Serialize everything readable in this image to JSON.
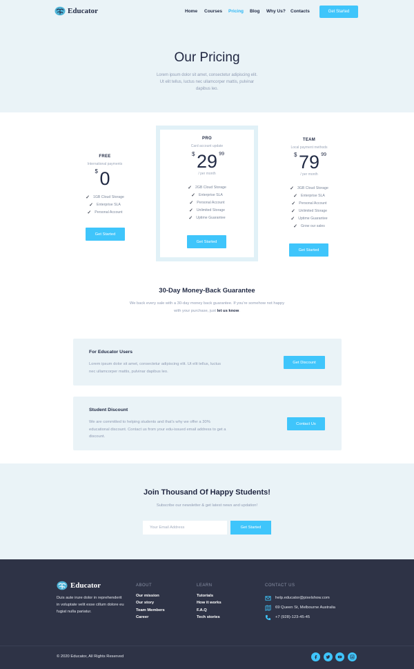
{
  "brand": {
    "name": "Educator",
    "accent": "#3fc5fb"
  },
  "nav": {
    "items": [
      {
        "label": "Home",
        "active": false
      },
      {
        "label": "Courses",
        "active": false
      },
      {
        "label": "Pricing",
        "active": true
      },
      {
        "label": "Blog",
        "active": false
      },
      {
        "label": "Why Us?",
        "active": false
      },
      {
        "label": "Contacts",
        "active": false
      }
    ],
    "cta": "Get Started"
  },
  "hero": {
    "title": "Our Pricing",
    "subtitle": "Lorem ipsum dolor sit amet, consectetur adipiscing elit. Ut elit tellus, luctus nec ullamcorper mattis, pulvinar dapibus leo."
  },
  "plans": [
    {
      "name": "FREE",
      "desc": "International payments",
      "currency": "$",
      "amount": "0",
      "cents": "",
      "period": "",
      "features": [
        "1GB Cloud Storage",
        "Enterprise SLA",
        "Personal Account"
      ],
      "button": "Get Started"
    },
    {
      "name": "PRO",
      "desc": "Card account update",
      "currency": "$",
      "amount": "29",
      "cents": "99",
      "period": "/ per month",
      "features": [
        "2GB Cloud Storage",
        "Enterprise SLA",
        "Personal Account",
        "Unlimited Storage",
        "Uptime Guarantee"
      ],
      "button": "Get Started"
    },
    {
      "name": "TEAM",
      "desc": "Local payment methods",
      "currency": "$",
      "amount": "79",
      "cents": "99",
      "period": "/ per month",
      "features": [
        "3GB Cloud Storage",
        "Enterprise SLA",
        "Personal Account",
        "Unlimited Storage",
        "Uptime Guarantee",
        "Grow our sales"
      ],
      "button": "Get Started"
    }
  ],
  "guarantee": {
    "title": "30-Day Money-Back Guarantee",
    "text": "We back every sale with a 30-day money back guarantee. If you're somehow not happy with your purchase, just",
    "link": "let us know",
    "end": "."
  },
  "cards": [
    {
      "title": "For Educator Users",
      "text": "Lorem ipsum dolor sit amet, consectetur adipiscing elit. Ut elit tellus, luctus nec ullamcorper mattis, pulvinar dapibus leo.",
      "button": "Get Discount"
    },
    {
      "title": "Student Discount",
      "text": "We are committed to helping students and that's why we offer a 30% educational discount. Contact us from your edu-issued email address to get a discount.",
      "button": "Contact Us"
    }
  ],
  "newsletter": {
    "title": "Join Thousand Of Happy Students!",
    "subtitle": "Subscribe our newsletter & get latest news and updation!",
    "placeholder": "Your Email Address",
    "button": "Get Started"
  },
  "footer": {
    "brand": "Educator",
    "about": "Duis aute irure dolor in reprehenderit in voluptate velit esse cillum dolore eu fugiat nulla pariatur.",
    "columns": [
      {
        "heading": "ABOUT",
        "links": [
          "Our mission",
          "Our story",
          "Team Members",
          "Career"
        ]
      },
      {
        "heading": "LEARN",
        "links": [
          "Tutorials",
          "How it works",
          "F.A.Q",
          "Tech stories"
        ]
      }
    ],
    "contact": {
      "heading": "CONTACT US",
      "email": "help.educator@pixelshow.com",
      "address": "69 Queen St, Melbourne Australia",
      "phone": "+7 (928)-123-45-45"
    },
    "copyright": "© 2020 Educator, All Rights Reserved",
    "socials": [
      "facebook-icon",
      "twitter-icon",
      "youtube-icon",
      "linkedin-icon"
    ]
  }
}
